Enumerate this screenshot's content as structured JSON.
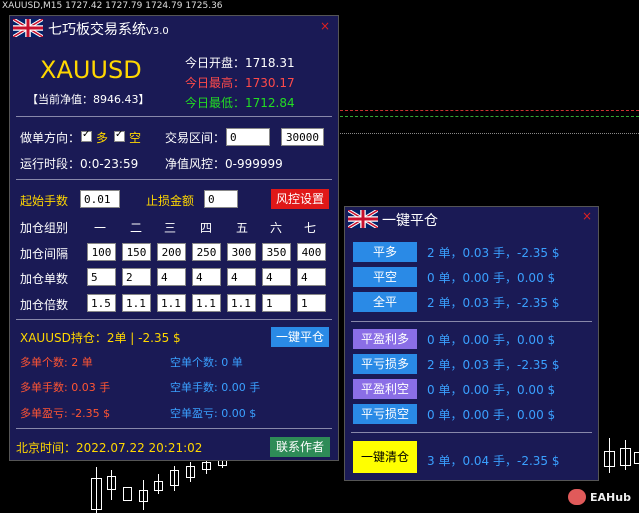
{
  "chart": {
    "header": "XAUUSD,M15  1727.42 1727.79 1724.79 1725.36"
  },
  "main": {
    "title": "七巧板交易系统",
    "version": "V3.0",
    "close": "×",
    "symbol": "XAUUSD",
    "equity_label": "【当前净值：8946.43】",
    "open_label": "今日开盘：",
    "open_value": "1718.31",
    "high_label": "今日最高：",
    "high_value": "1730.17",
    "low_label": "今日最低：",
    "low_value": "1712.84",
    "direction_label": "做单方向：",
    "long_label": "多",
    "short_label": "空",
    "range_label": "交易区间：",
    "range_from": "0",
    "range_to": "30000",
    "session_label": "运行时段：",
    "session_value": "0:0-23:59",
    "risk_label": "净值风控：",
    "risk_value": "0-999999",
    "start_lots_label": "起始手数",
    "start_lots_value": "0.01",
    "stop_amount_label": "止损金额",
    "stop_amount_value": "0",
    "risk_button": "风控设置",
    "grid_group_label": "加仓组别",
    "grid_groups": [
      "一",
      "二",
      "三",
      "四",
      "五",
      "六",
      "七"
    ],
    "interval_label": "加仓间隔",
    "intervals": [
      "100",
      "150",
      "200",
      "250",
      "300",
      "350",
      "400"
    ],
    "count_label": "加仓单数",
    "counts": [
      "5",
      "2",
      "4",
      "4",
      "4",
      "4",
      "4"
    ],
    "multiple_label": "加仓倍数",
    "multiples": [
      "1.5",
      "1.1",
      "1.1",
      "1.1",
      "1.1",
      "1",
      "1"
    ],
    "position_label": "XAUUSD持仓：2单 | -2.35 $",
    "close_all_button": "一键平仓",
    "long_count": "多单个数: 2 单",
    "short_count": "空单个数: 0 单",
    "long_lots": "多单手数: 0.03 手",
    "short_lots": "空单手数: 0.00 手",
    "long_profit": "多单盈亏: -2.35 $",
    "short_profit": "空单盈亏: 0.00 $",
    "time_label": "北京时间：2022.07.22 20:21:02",
    "contact_button": "联系作者"
  },
  "side": {
    "title": "一键平仓",
    "close": "×",
    "rows": [
      {
        "button": "平多",
        "info": "2 单，0.03 手，-2.35 $"
      },
      {
        "button": "平空",
        "info": "0 单，0.00 手，0.00 $"
      },
      {
        "button": "全平",
        "info": "2 单，0.03 手，-2.35 $"
      },
      {
        "button": "平盈利多",
        "info": "0 单，0.00 手，0.00 $"
      },
      {
        "button": "平亏损多",
        "info": "2 单，0.03 手，-2.35 $"
      },
      {
        "button": "平盈利空",
        "info": "0 单，0.00 手，0.00 $"
      },
      {
        "button": "平亏损空",
        "info": "0 单，0.00 手，0.00 $"
      },
      {
        "button": "一键清仓",
        "info": "3 单，0.04 手，-2.35 $"
      }
    ]
  },
  "watermark": "EAHub",
  "colors": {
    "panel_bg": "#1a1a55",
    "accent_yellow": "#ffd700",
    "loss_red": "#ff4a4a",
    "gain_green": "#22dd22",
    "button_blue": "#2a8ae6"
  }
}
